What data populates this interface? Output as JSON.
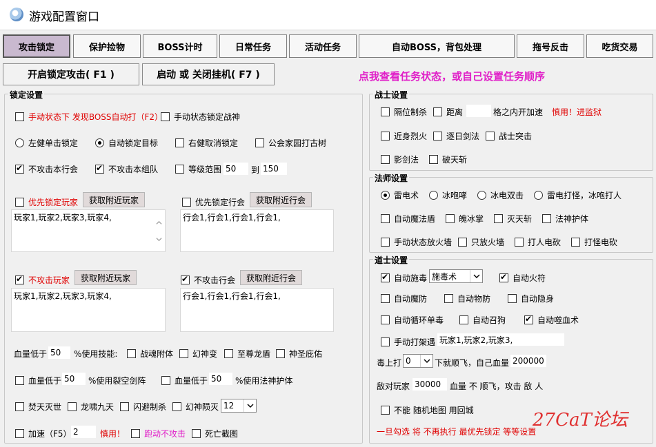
{
  "window": {
    "title": "游戏配置窗口"
  },
  "tabs": [
    {
      "label": "攻击锁定",
      "active": true
    },
    {
      "label": "保护捡物"
    },
    {
      "label": "BOSS计时"
    },
    {
      "label": "日常任务"
    },
    {
      "label": "活动任务"
    },
    {
      "label": "自动BOSS，背包处理"
    },
    {
      "label": "拖号反击"
    },
    {
      "label": "吃货交易"
    }
  ],
  "actions": {
    "start_lock": "开启锁定攻击( F1 )",
    "toggle_hang": "启动 或 关闭挂机( F7 )",
    "task_link": "点我查看任务状态，或自己设置任务顺序"
  },
  "lock": {
    "legend": "锁定设置",
    "manual_boss": "手动状态下 发现BOSS自动打（F2）",
    "manual_lock_god": "手动状态锁定战神",
    "left_click_lock": "左健单击锁定",
    "auto_lock_target": "自动锁定目标",
    "right_click_cancel": "右健取消锁定",
    "guild_home_tree": "公会家园打古树",
    "no_attack_guild": "不攻击本行会",
    "no_attack_team": "不攻击本组队",
    "level_range": "等级范围",
    "level_from": "50",
    "level_to_label": "到",
    "level_to": "150",
    "prio_player": "优先锁定玩家",
    "prio_guild": "优先锁定行会",
    "fetch_players_1": "获取附近玩家",
    "fetch_guilds_1": "获取附近行会",
    "players_list_1": "玩家1,玩家2,玩家3,玩家4,",
    "guilds_list_1": "行会1,行会1,行会1,行会1,",
    "no_attack_player": "不攻击玩家",
    "no_attack_guild2": "不攻击行会",
    "fetch_players_2": "获取附近玩家",
    "fetch_guilds_2": "获取附近行会",
    "players_list_2": "玩家1,玩家2,玩家3,玩家4,",
    "guilds_list_2": "行会1,行会1,行会1,行会1,",
    "hp_low_label": "血量低于",
    "hp_low_value": "50",
    "use_skill_label": "%使用技能:",
    "skill_soul": "战魂附体",
    "skill_phantom": "幻神变",
    "skill_dragon_shield": "至尊龙盾",
    "skill_holy": "神圣庇佑",
    "hp_low2_label": "血量低于",
    "hp_low2_value": "50",
    "use_rift_label": "%使用裂空剑阵",
    "hp_low3_label": "血量低于",
    "hp_low3_value": "50",
    "use_divine_label": "%使用法神护体",
    "burn_world": "焚天灭世",
    "dragon_roar": "龙啸九天",
    "dodge_kill": "闪避制杀",
    "phantom_fall": "幻神陨灭",
    "phantom_fall_value": "12",
    "speed_label": "加速（F5）",
    "speed_value": "2",
    "caution": "慎用！",
    "run_no_attack": "跑动不攻击",
    "death_screenshot": "死亡截图"
  },
  "warrior": {
    "legend": "战士设置",
    "block_kill": "隔位制杀",
    "distance_label": "距离",
    "distance_suffix": "格之内开加速",
    "distance_warn": "慎用！进监狱",
    "near_fire": "近身烈火",
    "sun_sword": "逐日剑法",
    "warrior_charge": "战士突击",
    "shadow_sword": "影剑法",
    "break_sky": "破天斩"
  },
  "mage": {
    "legend": "法师设置",
    "thunder": "雷电术",
    "ice_roar": "冰咆哮",
    "ice_thunder": "冰电双击",
    "thunder_mob": "雷电打怪，冰咆打人",
    "auto_shield": "自动魔法盾",
    "ice_palm": "魄冰掌",
    "annihilate": "灭天斩",
    "god_guard": "法神护体",
    "manual_fire_wall": "手动状态放火墙",
    "only_fire_wall": "只放火墙",
    "hit_people_elec": "打人电砍",
    "hit_mob_elec": "打怪电砍"
  },
  "taoist": {
    "legend": "道士设置",
    "auto_poison": "自动施毒",
    "poison_select": "施毒术",
    "auto_talisman": "自动火符",
    "auto_magic_def": "自动魔防",
    "auto_phys_def": "自动物防",
    "auto_invisible": "自动隐身",
    "auto_cycle_poison": "自动循环单毒",
    "auto_summon_dog": "自动召狗",
    "auto_bloodsuck": "自动噬血术",
    "manual_fight": "手动打架遇",
    "fight_players": "玩家1,玩家2,玩家3,",
    "poison_on_label": "毒上打",
    "poison_on_value": "0",
    "down_fly_label": "下就顺飞，自己血量",
    "self_hp_value": "200000",
    "enemy_player_label": "敌对玩家",
    "enemy_player_value": "30000",
    "enemy_hp_note": "血量 不 顺飞，攻击 敌 人",
    "no_random_map": "不能 随机地图 用回城",
    "footnote": "一旦勾选 将 不再执行 最优先锁定 等等设置"
  },
  "watermark": "27CaT论坛",
  "colors": {
    "accent_red": "#e00000",
    "magenta": "#e020c8",
    "active_tab": "#c9b9cf"
  }
}
